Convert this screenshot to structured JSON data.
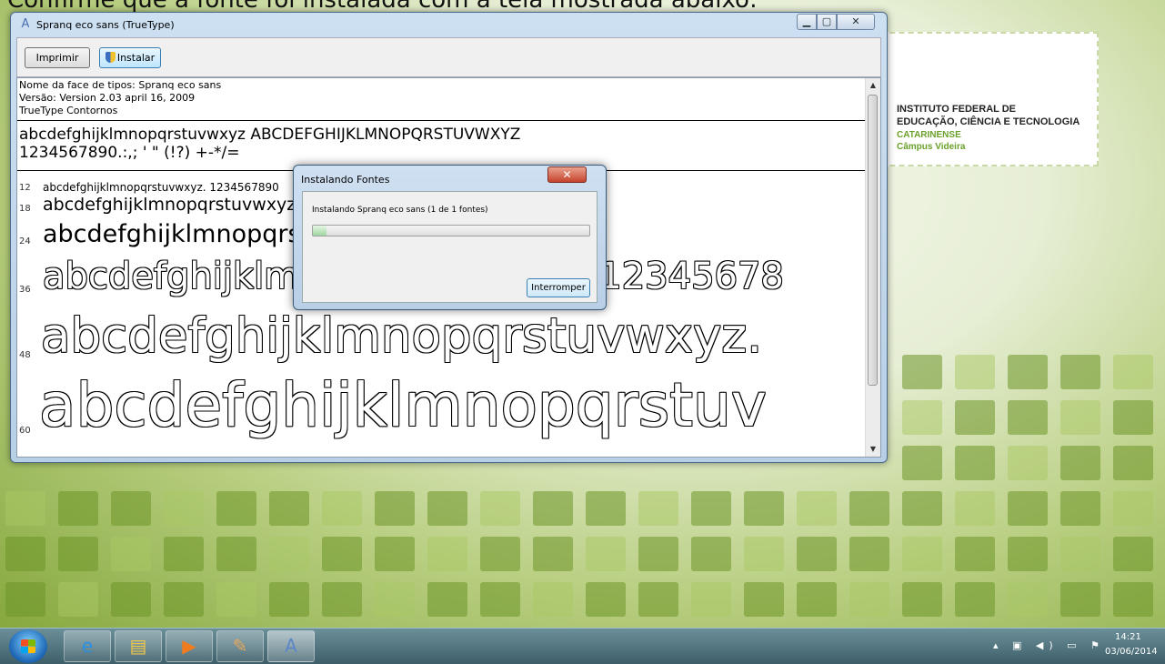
{
  "caption": "Confirme que a fonte foi instalada com a tela mostrada abaixo:",
  "logo": {
    "line1": "INSTITUTO FEDERAL DE",
    "line2": "EDUCAÇÃO, CIÊNCIA E TECNOLOGIA",
    "line3": "CATARINENSE",
    "line4": "Câmpus Videira"
  },
  "window": {
    "title": "Spranq eco sans (TrueType)",
    "min_icon": "minimize-icon",
    "max_icon": "maximize-icon",
    "close_icon": "close-icon",
    "toolbar": {
      "print_label": "Imprimir",
      "install_label": "Instalar"
    },
    "info": {
      "face_name": "Nome da face de tipos: Spranq eco sans",
      "version": "Versão: Version 2.03 april 16, 2009",
      "type": "TrueType Contornos"
    },
    "sample_lines": [
      "abcdefghijklmnopqrstuvwxyz ABCDEFGHIJKLMNOPQRSTUVWXYZ",
      "1234567890.:,; ' \" (!?) +-*/="
    ],
    "size_rows": [
      {
        "size": "12",
        "text": "abcdefghijklmnopqrstuvwxyz. 1234567890"
      },
      {
        "size": "18",
        "text": "abcdefghijklmnopqrstuvwxyz. 1234567890"
      },
      {
        "size": "24",
        "text": "abcdefghijklmnopqrstuvwxyz. 1234567890"
      },
      {
        "size": "36",
        "text": "abcdefghijklmnopqrstuvwxyz. 12345678"
      },
      {
        "size": "48",
        "text": "abcdefghijklmnopqrstuvwxyz."
      },
      {
        "size": "60",
        "text": "abcdefghijklmnopqrstuv"
      }
    ]
  },
  "dialog": {
    "title": "Instalando Fontes",
    "message": "Instalando Spranq eco sans (1 de 1 fontes)",
    "progress": 0.05,
    "stop_label": "Interromper",
    "close_icon": "close-icon"
  },
  "taskbar": {
    "apps": [
      "internet-explorer-icon",
      "file-explorer-icon",
      "media-player-icon",
      "paint-icon",
      "font-viewer-icon"
    ],
    "time": "14:21",
    "date": "03/06/2014"
  }
}
